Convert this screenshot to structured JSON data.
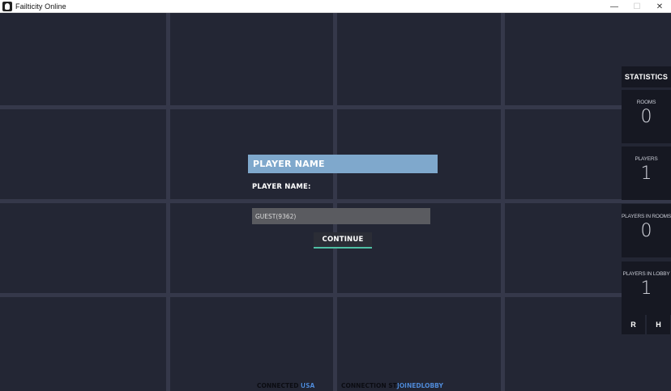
{
  "window": {
    "title": "Failticity Online",
    "minimize": "—",
    "maximize": "☐",
    "close": "✕"
  },
  "dialog": {
    "header": "PLAYER NAME",
    "name_label": "PLAYER NAME:",
    "name_value": "GUEST(9362)",
    "continue_label": "CONTINUE"
  },
  "stats": {
    "title": "STATISTICS",
    "items": [
      {
        "label": "ROOMS",
        "value": "0"
      },
      {
        "label": "PLAYERS",
        "value": "1"
      },
      {
        "label": "PLAYERS IN ROOMS",
        "value": "0"
      },
      {
        "label": "PLAYERS IN LOBBY",
        "value": "1"
      }
    ],
    "r_label": "R",
    "h_label": "H"
  },
  "status": {
    "connected_label": "CONNECTED TO:",
    "connected_value": "USA",
    "state_label": "CONNECTION STATE:",
    "state_value": "JOINEDLOBBY"
  },
  "colors": {
    "header": "#7fa8cc",
    "accent": "#4fbfa4",
    "link": "#4f8ad8"
  }
}
